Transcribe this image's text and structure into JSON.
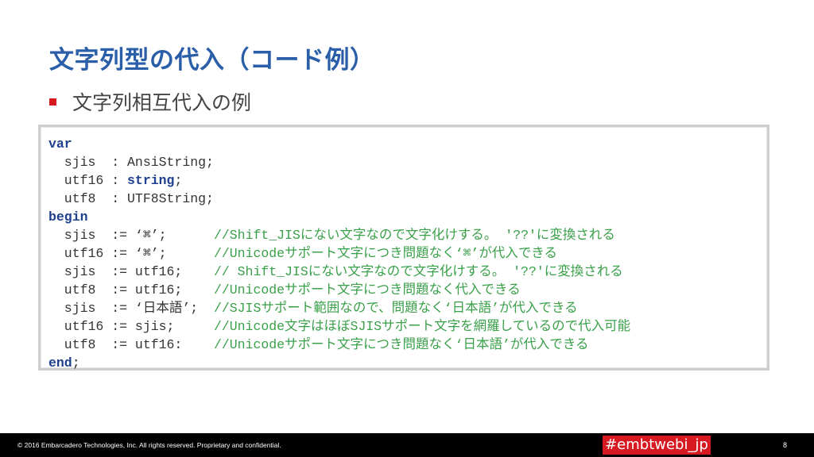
{
  "slide": {
    "title": "文字列型の代入（コード例）",
    "bullet": "文字列相互代入の例"
  },
  "code": {
    "line1": {
      "kw": "var"
    },
    "line2": {
      "text": "  sjis  : AnsiString;"
    },
    "line3": {
      "pre": "  utf16 : ",
      "kw": "string",
      "post": ";"
    },
    "line4": {
      "text": "  utf8  : UTF8String;"
    },
    "line5": {
      "kw": "begin"
    },
    "line6": {
      "code": "  sjis  := ‘⌘’;      ",
      "comment": "//Shift_JISにない文字なので文字化けする。 '??'に変換される"
    },
    "line7": {
      "code": "  utf16 := ‘⌘’;      ",
      "comment": "//Unicodeサポート文字につき問題なく‘⌘’が代入できる"
    },
    "line8": {
      "code": "  sjis  := utf16;    ",
      "comment": "// Shift_JISにない文字なので文字化けする。 '??'に変換される"
    },
    "line9": {
      "code": "  utf8  := utf16;    ",
      "comment": "//Unicodeサポート文字につき問題なく代入できる"
    },
    "line10": {
      "code": "  sjis  := ‘日本語’;  ",
      "comment": "//SJISサポート範囲なので、問題なく‘日本語’が代入できる"
    },
    "line11": {
      "code": "  utf16 := sjis;     ",
      "comment": "//Unicode文字はほぼSJISサポート文字を網羅しているので代入可能"
    },
    "line12": {
      "code": "  utf8  := utf16:    ",
      "comment": "//Unicodeサポート文字につき問題なく‘日本語’が代入できる"
    },
    "line13": {
      "kw": "end",
      "post": ";"
    }
  },
  "footer": {
    "copyright": "© 2016 Embarcadero Technologies, Inc. All rights reserved. Proprietary and confidential.",
    "hashtag": "#embtwebi_jp",
    "page_number": "8"
  },
  "colors": {
    "title": "#2a5ea8",
    "bullet": "#d71921",
    "keyword": "#1f3f8f",
    "comment": "#3aa04a",
    "hashtag_bg": "#d71921"
  }
}
